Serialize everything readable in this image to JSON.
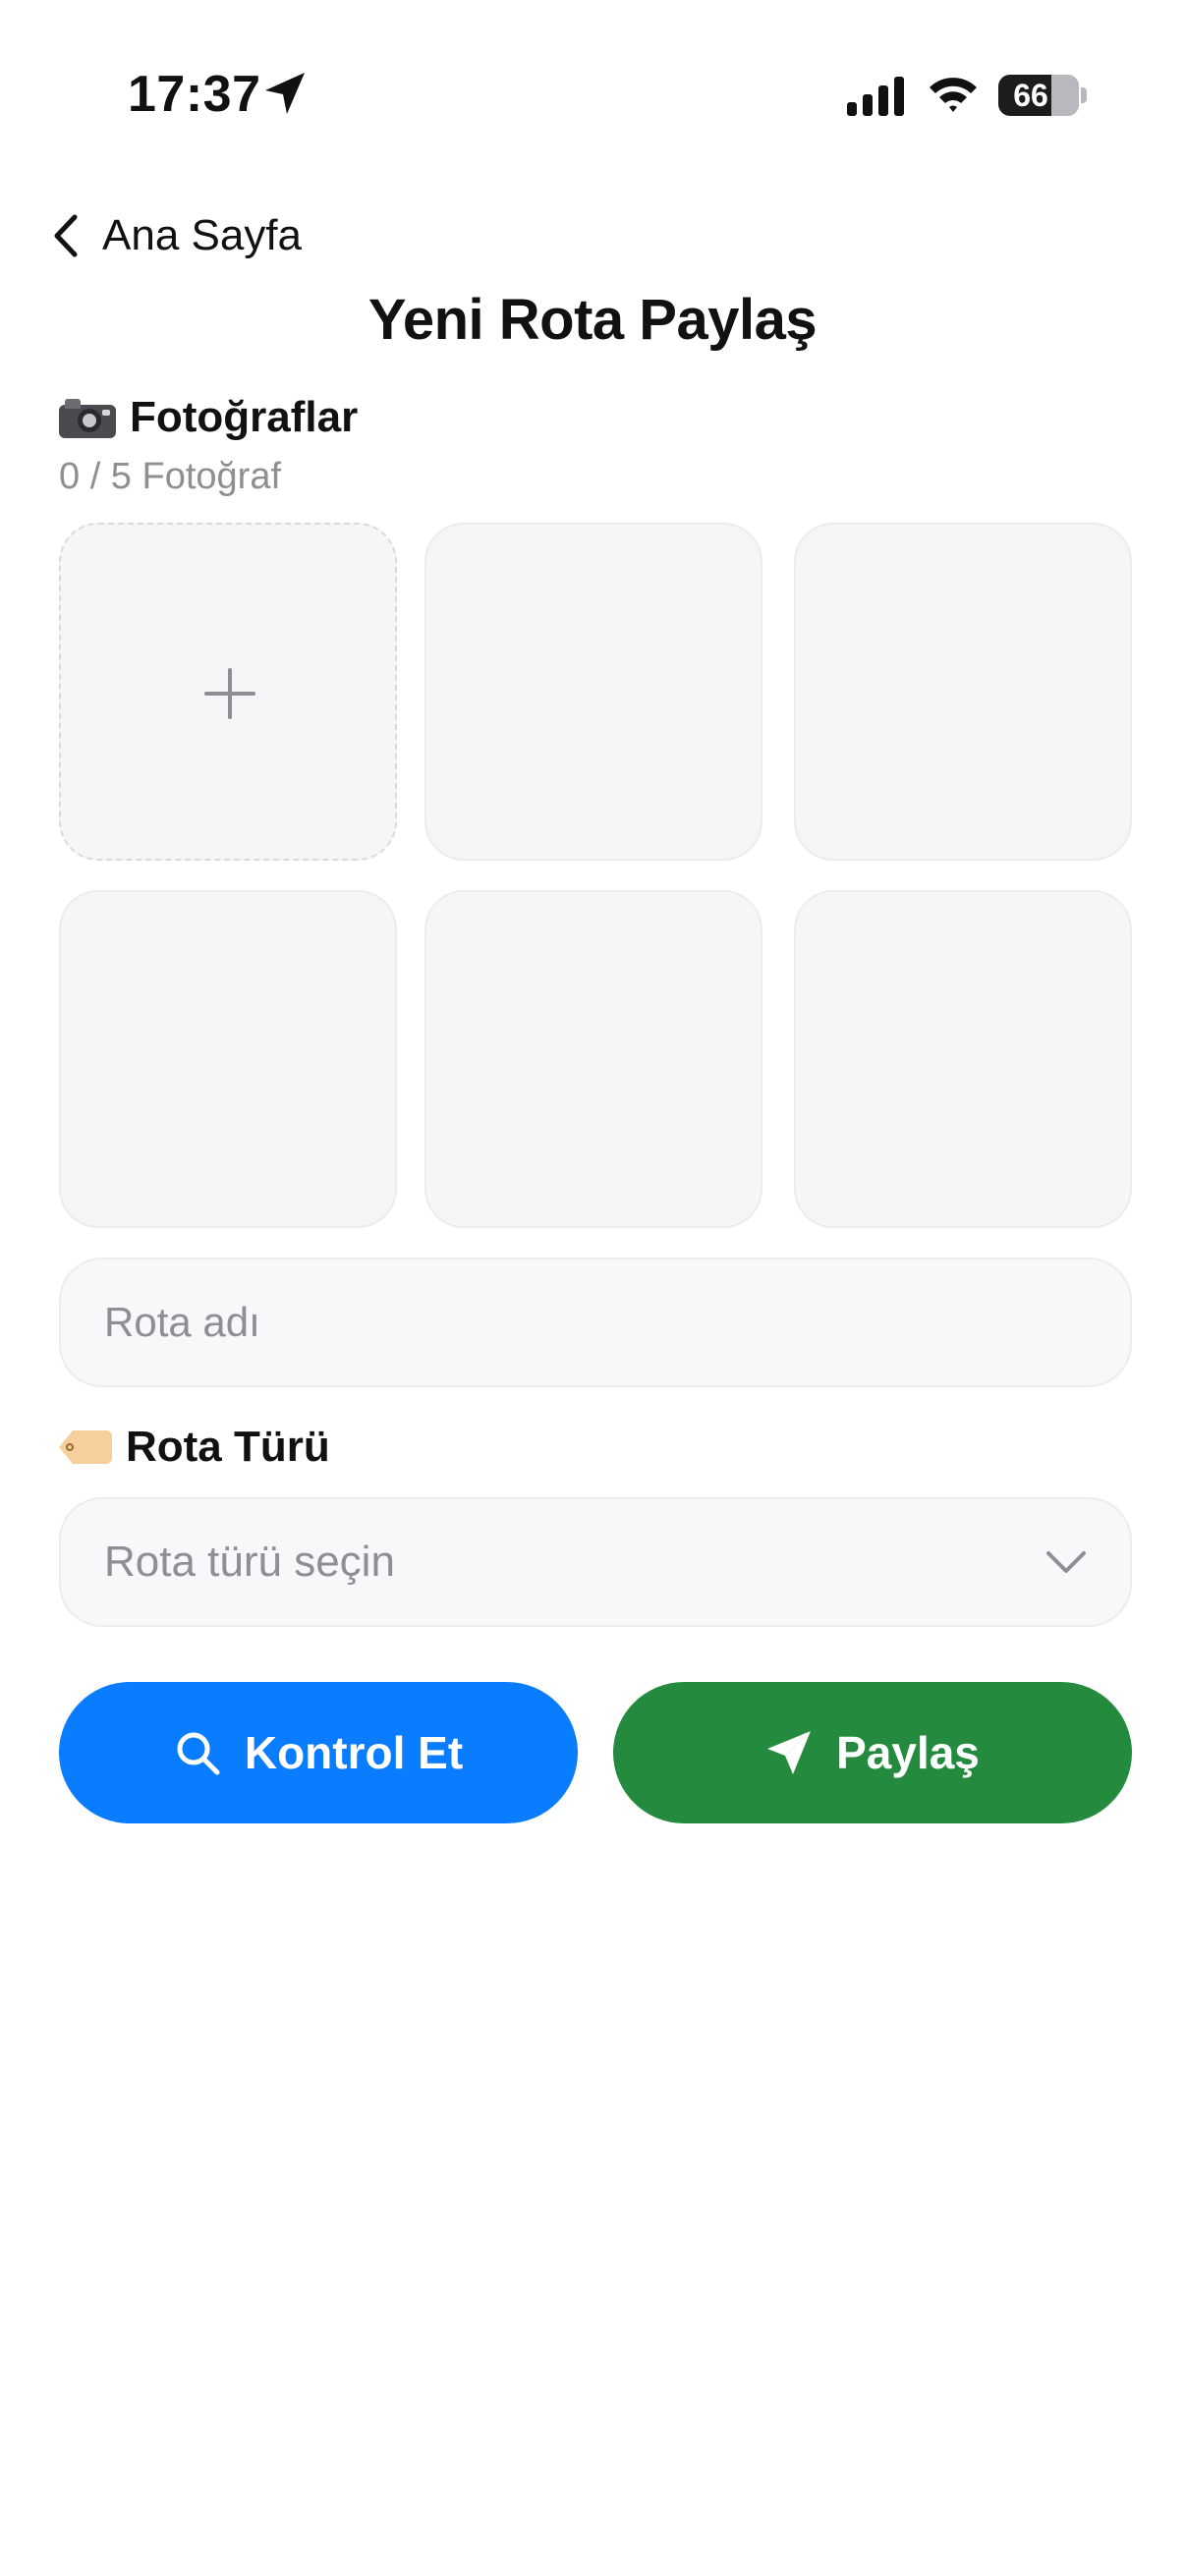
{
  "status_bar": {
    "time": "17:37",
    "battery_level": "66",
    "icons": [
      "location-arrow-icon",
      "cellular-signal-icon",
      "wifi-icon",
      "battery-icon"
    ]
  },
  "nav": {
    "back_label": "Ana Sayfa",
    "title": "Yeni Rota Paylaş"
  },
  "photos": {
    "heading": "Fotoğraflar",
    "heading_icon": "camera-icon",
    "count_label": "0 / 5 Fotoğraf",
    "max_photos": 5,
    "selected_photos": 0,
    "add_icon": "plus-icon"
  },
  "route_name": {
    "placeholder": "Rota adı",
    "value": ""
  },
  "route_type": {
    "heading": "Rota Türü",
    "heading_icon": "tag-icon",
    "selected_label": "Rota türü seçin",
    "dropdown_icon": "chevron-down-icon"
  },
  "actions": {
    "check_label": "Kontrol Et",
    "check_icon": "magnifying-glass-icon",
    "share_label": "Paylaş",
    "share_icon": "paper-plane-icon"
  },
  "colors": {
    "check_button": "#0a7cff",
    "share_button": "#248a3d",
    "tile_background": "#f6f6f8",
    "placeholder_text": "#8e8e93"
  }
}
